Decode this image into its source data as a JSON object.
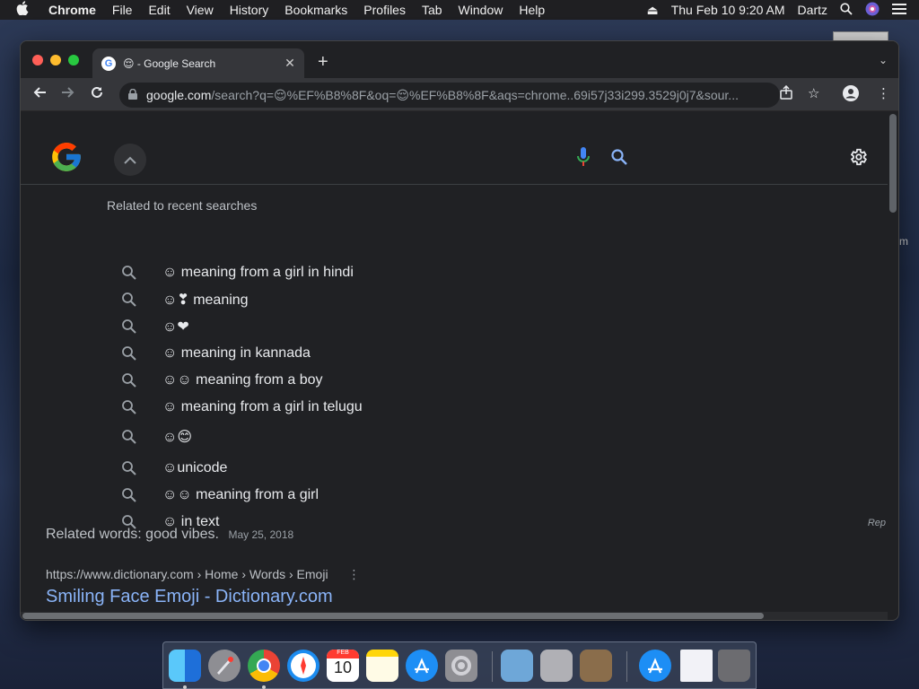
{
  "menubar": {
    "apple": "",
    "items": [
      "Chrome",
      "File",
      "Edit",
      "View",
      "History",
      "Bookmarks",
      "Profiles",
      "Tab",
      "Window",
      "Help"
    ],
    "datetime": "Thu Feb 10  9:20 AM",
    "user": "Dartz"
  },
  "browser": {
    "tab_title": "😌 - Google Search",
    "url_host": "google.com",
    "url_path": "/search?q=😌%EF%B8%8F&oq=😌%EF%B8%8F&aqs=chrome..69i57j33i299.3529j0j7&sour..."
  },
  "google": {
    "related_title": "Related to recent searches",
    "suggestions": [
      "☺ meaning from a girl in hindi",
      "☺❣ meaning",
      "☺❤",
      "☺ meaning in kannada",
      "☺☺ meaning from a boy",
      "☺ meaning from a girl in telugu",
      "☺😊",
      "☺unicode",
      "☺☺ meaning from a girl",
      "☺ in text"
    ],
    "related_words": "Related words: good vibes.",
    "related_date": "May 25, 2018",
    "rep_label": "Rep",
    "result_url": "https://www.dictionary.com › Home › Words › Emoji",
    "result_more": "⋮",
    "result_title": "Smiling Face Emoji - Dictionary.com"
  },
  "desktop": {
    "hint": "m"
  },
  "dock": {
    "apps": [
      "finder-icon",
      "launchpad-icon",
      "chrome-icon",
      "safari-icon",
      "calendar-icon",
      "notes-icon",
      "app-store-icon",
      "system-preferences-icon",
      "migration-icon",
      "utility-icon",
      "reader-icon",
      "downloads-icon",
      "document-icon",
      "trash-icon"
    ],
    "calendar_month": "FEB",
    "calendar_day": "10"
  }
}
